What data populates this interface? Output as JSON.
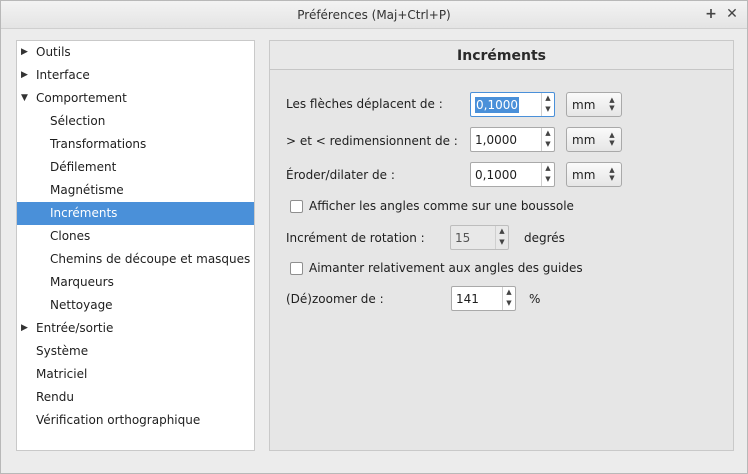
{
  "window": {
    "title": "Préférences (Maj+Ctrl+P)",
    "pin_glyph": "+",
    "close_glyph": "✕"
  },
  "sidebar": {
    "items": [
      {
        "label": "Outils",
        "arrow": "▶",
        "level": 0
      },
      {
        "label": "Interface",
        "arrow": "▶",
        "level": 0
      },
      {
        "label": "Comportement",
        "arrow": "▼",
        "level": 0
      },
      {
        "label": "Sélection",
        "arrow": "",
        "level": 1
      },
      {
        "label": "Transformations",
        "arrow": "",
        "level": 1
      },
      {
        "label": "Défilement",
        "arrow": "",
        "level": 1
      },
      {
        "label": "Magnétisme",
        "arrow": "",
        "level": 1
      },
      {
        "label": "Incréments",
        "arrow": "",
        "level": 1,
        "selected": true
      },
      {
        "label": "Clones",
        "arrow": "",
        "level": 1
      },
      {
        "label": "Chemins de découpe et masques",
        "arrow": "",
        "level": 1
      },
      {
        "label": "Marqueurs",
        "arrow": "",
        "level": 1
      },
      {
        "label": "Nettoyage",
        "arrow": "",
        "level": 1
      },
      {
        "label": "Entrée/sortie",
        "arrow": "▶",
        "level": 0
      },
      {
        "label": "Système",
        "arrow": "",
        "level": 0
      },
      {
        "label": "Matriciel",
        "arrow": "",
        "level": 0
      },
      {
        "label": "Rendu",
        "arrow": "",
        "level": 0
      },
      {
        "label": "Vérification orthographique",
        "arrow": "",
        "level": 0
      }
    ]
  },
  "panel": {
    "title": "Incréments",
    "arrow_keys": {
      "label": "Les flèches déplacent de :",
      "value": "0,1000",
      "unit": "mm"
    },
    "resize": {
      "label": "> et < redimensionnent de :",
      "value": "1,0000",
      "unit": "mm"
    },
    "erode": {
      "label": "Éroder/dilater de :",
      "value": "0,1000",
      "unit": "mm"
    },
    "compass": {
      "label": "Afficher les angles comme sur une boussole",
      "checked": false
    },
    "rotation": {
      "label": "Incrément de rotation :",
      "value": "15",
      "unit": "degrés"
    },
    "guides": {
      "label": "Aimanter relativement aux angles des guides",
      "checked": false
    },
    "zoom": {
      "label": "(Dé)zoomer de :",
      "value": "141",
      "unit": "%"
    }
  },
  "glyphs": {
    "up": "▲",
    "down": "▼"
  },
  "colors": {
    "selection": "#4a90d9"
  }
}
